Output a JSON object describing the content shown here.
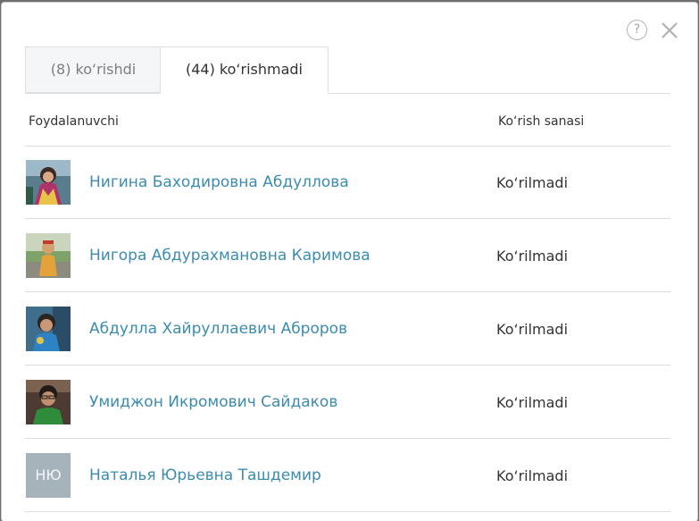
{
  "tabs": {
    "seen_label": "(8) ko‘rishdi",
    "unseen_label": "(44) ko‘rishmadi"
  },
  "table": {
    "col_user": "Foydalanuvchi",
    "col_date": "Ko‘rish sanasi",
    "rows": [
      {
        "name": "Нигина Баходировна Абдуллова",
        "status": "Ko‘rilmadi"
      },
      {
        "name": "Нигора Абдурахмановна Каримова",
        "status": "Ko‘rilmadi"
      },
      {
        "name": "Абдулла Хайруллаевич Аброров",
        "status": "Ko‘rilmadi"
      },
      {
        "name": "Умиджон Икромович Сайдаков",
        "status": "Ko‘rilmadi"
      },
      {
        "name": "Наталья Юрьевна Ташдемир",
        "status": "Ko‘rilmadi",
        "initials": "НЮ"
      }
    ]
  },
  "icons": {
    "help": "help-icon",
    "help_glyph": "?",
    "close": "close-icon"
  },
  "colors": {
    "link": "#3b8cb0",
    "initials_bg": "#a7b3bb"
  }
}
